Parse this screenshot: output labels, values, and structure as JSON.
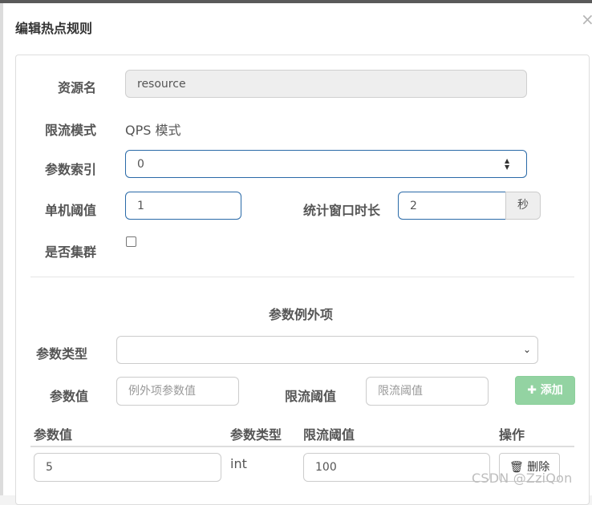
{
  "dialog": {
    "title": "编辑热点规则",
    "close_icon": "×"
  },
  "form": {
    "resource_label": "资源名",
    "resource_value": "resource",
    "mode_label": "限流模式",
    "mode_value": "QPS 模式",
    "param_index_label": "参数索引",
    "param_index_value": "0",
    "threshold_label": "单机阈值",
    "threshold_value": "1",
    "window_label": "统计窗口时长",
    "window_value": "2",
    "window_unit": "秒",
    "cluster_label": "是否集群",
    "cluster_checked": false
  },
  "exceptions": {
    "section_title": "参数例外项",
    "param_type_label": "参数类型",
    "param_type_selected": "",
    "param_value_label": "参数值",
    "param_value_placeholder": "例外项参数值",
    "limit_label": "限流阈值",
    "limit_placeholder": "限流阈值",
    "add_button_label": "添加",
    "add_icon": "plus-icon",
    "table": {
      "headers": [
        "参数值",
        "参数类型",
        "限流阈值",
        "操作"
      ],
      "rows": [
        {
          "param_value": "5",
          "param_type": "int",
          "limit": "100",
          "action_label": "删除",
          "action_icon": "trash-icon"
        }
      ]
    }
  },
  "watermark": "CSDN @ZziQon",
  "colors": {
    "focus_border": "#2a6aa8",
    "add_button_bg": "#93d3a2",
    "disabled_bg": "#eeeeee"
  }
}
